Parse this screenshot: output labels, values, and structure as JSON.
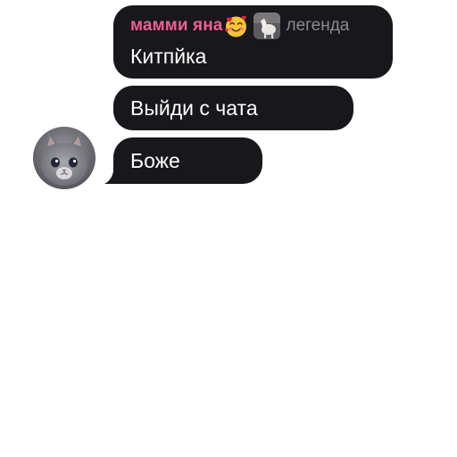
{
  "chat": {
    "sender": {
      "name": "мамми яна",
      "emoji_icon": "smiling-face-with-hearts-icon",
      "badge_image": "white-horse-picture",
      "title": "легенда",
      "name_color": "#ef5f93",
      "title_color": "#8b8b92"
    },
    "messages": [
      {
        "text": "Китпйка"
      },
      {
        "text": "Выйди с чата"
      },
      {
        "text": "Боже"
      }
    ],
    "avatar": {
      "description_icon": "grey-kitten-avatar"
    },
    "colors": {
      "bubble": "#18171b",
      "text": "#ffffff",
      "background": "#ffffff"
    }
  }
}
